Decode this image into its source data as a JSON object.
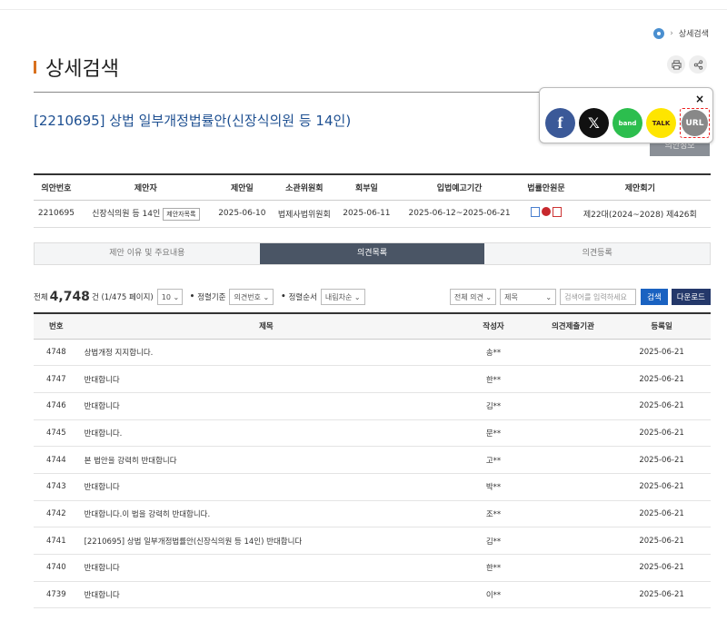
{
  "breadcrumb": {
    "current": "상세검색"
  },
  "page": {
    "title": "상세검색"
  },
  "bill": {
    "title": "[2210695] 상법 일부개정법률안(신장식의원 등 14인)",
    "info_button": "의안정보"
  },
  "share": {
    "close": "×",
    "facebook": "f",
    "x": "𝕏",
    "band": "band",
    "kakao": "TALK",
    "url": "URL"
  },
  "info_table": {
    "headers": [
      "의안번호",
      "제안자",
      "제안일",
      "소관위원회",
      "회부일",
      "입법예고기간",
      "법률안원문",
      "제안회기"
    ],
    "bill_no": "2210695",
    "proposer": "신장식의원 등 14인",
    "proposer_list_btn": "제안자목록",
    "proposed_date": "2025-06-10",
    "committee": "법제사법위원회",
    "referral_date": "2025-06-11",
    "notice_period": "2025-06-12~2025-06-21",
    "session": "제22대(2024~2028) 제426회"
  },
  "tabs": [
    {
      "label": "제안 이유 및 주요내용"
    },
    {
      "label": "의견목록"
    },
    {
      "label": "의견등록"
    }
  ],
  "list_header": {
    "total_prefix": "전체",
    "total_count": "4,748",
    "total_suffix": "건 (1/475 페이지)",
    "page_size": "10",
    "sort_key_label": "정렬기준",
    "sort_key": "의견번호",
    "sort_order_label": "정렬순서",
    "sort_order": "내림차순",
    "filter_scope": "전체 의견",
    "filter_field": "제목",
    "search_placeholder": "검색어를 입력하세요",
    "search_btn": "검색",
    "download_btn": "다운로드"
  },
  "list_columns": [
    "번호",
    "제목",
    "작성자",
    "의견제출기관",
    "등록일"
  ],
  "rows": [
    {
      "no": "4748",
      "title": "상법개정 지지합니다.",
      "author": "송**",
      "org": "",
      "date": "2025-06-21"
    },
    {
      "no": "4747",
      "title": "반대합니다",
      "author": "한**",
      "org": "",
      "date": "2025-06-21"
    },
    {
      "no": "4746",
      "title": "반대합니다",
      "author": "김**",
      "org": "",
      "date": "2025-06-21"
    },
    {
      "no": "4745",
      "title": "반대합니다.",
      "author": "문**",
      "org": "",
      "date": "2025-06-21"
    },
    {
      "no": "4744",
      "title": "본 법안을 강력히 반대합니다",
      "author": "고**",
      "org": "",
      "date": "2025-06-21"
    },
    {
      "no": "4743",
      "title": "반대합니다",
      "author": "박**",
      "org": "",
      "date": "2025-06-21"
    },
    {
      "no": "4742",
      "title": "반대합니다.이 법을 강력히 반대합니다.",
      "author": "조**",
      "org": "",
      "date": "2025-06-21"
    },
    {
      "no": "4741",
      "title": "[2210695] 상법 일부개정법률안(신장식의원 등 14인) 반대합니다",
      "author": "김**",
      "org": "",
      "date": "2025-06-21"
    },
    {
      "no": "4740",
      "title": "반대합니다",
      "author": "한**",
      "org": "",
      "date": "2025-06-21"
    },
    {
      "no": "4739",
      "title": "반대합니다",
      "author": "이**",
      "org": "",
      "date": "2025-06-21"
    }
  ]
}
